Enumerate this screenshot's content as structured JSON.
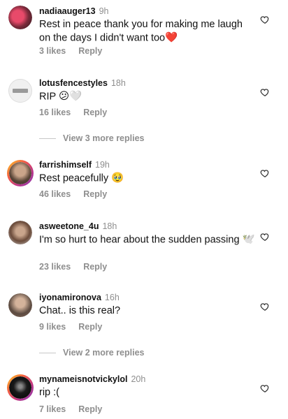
{
  "comments": [
    {
      "user": "nadiaauger13",
      "time": "9h",
      "text": "Rest in peace thank you for making me laugh on the days I didn't want too",
      "likes": "3 likes",
      "reply": "Reply",
      "emoji": "❤️"
    },
    {
      "user": "lotusfencestyles",
      "time": "18h",
      "text": "RIP",
      "likes": "16 likes",
      "reply": "Reply",
      "emoji": "😕🤍"
    },
    {
      "user": "farrishimself",
      "time": "19h",
      "text": "Rest peacefully",
      "likes": "46 likes",
      "reply": "Reply",
      "emoji": "🥹"
    },
    {
      "user": "asweetone_4u",
      "time": "18h",
      "text": "I'm so hurt to hear about the sudden passing",
      "likes": "23 likes",
      "reply": "Reply",
      "emoji": "🕊️"
    },
    {
      "user": "iyonamironova",
      "time": "16h",
      "text": "Chat.. is this real?",
      "likes": "9 likes",
      "reply": "Reply"
    },
    {
      "user": "mynameisnotvickylol",
      "time": "20h",
      "text": "rip :(",
      "likes": "7 likes",
      "reply": "Reply"
    }
  ],
  "view_more": [
    "View 3 more replies",
    "View 2 more replies"
  ],
  "icons": {
    "like": "heart-outline-icon"
  }
}
